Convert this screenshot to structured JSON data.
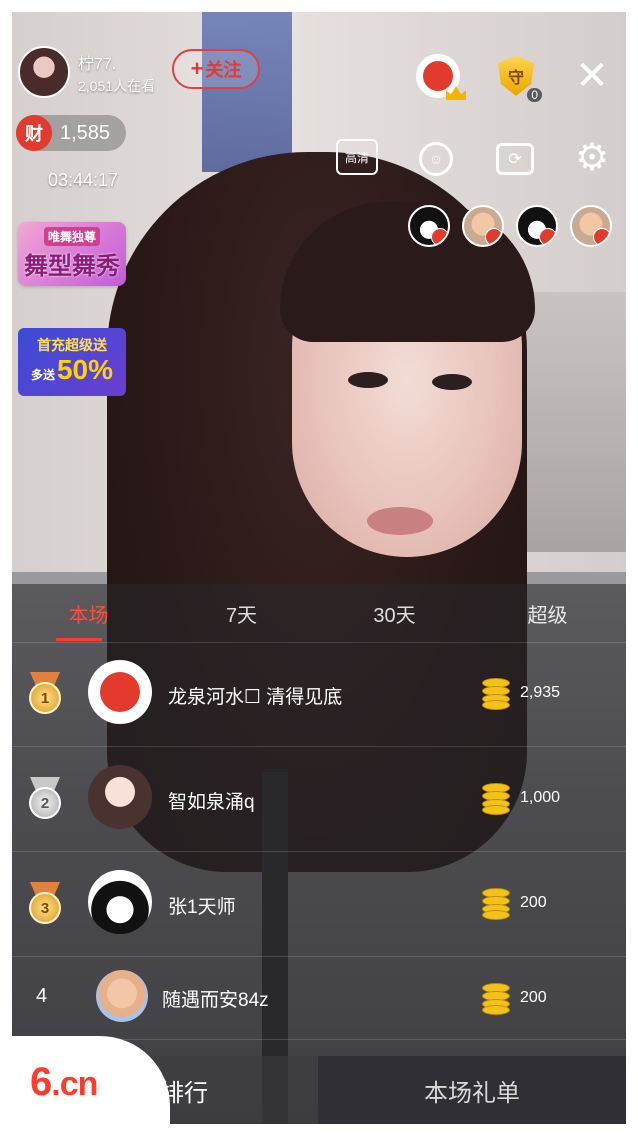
{
  "host": {
    "name": "柠77.",
    "viewers": "2,051人在看",
    "follow_label": "关注",
    "follow_plus": "+"
  },
  "wealth": {
    "icon_label": "财",
    "value": "1,585"
  },
  "timer": "03:44:17",
  "promos": {
    "banner1_top": "唯舞独尊",
    "banner1_main": "舞型舞秀",
    "banner2_top": "首充超级送",
    "banner2_prefix": "多送",
    "banner2_value": "50%"
  },
  "top_icons": {
    "guard_char": "守",
    "guard_count": "0",
    "close_glyph": "✕",
    "hd_label": "高清",
    "face_glyph": "☺",
    "camera_glyph": "⟳",
    "gear_glyph": "⚙"
  },
  "ranking": {
    "tabs": [
      "本场",
      "7天",
      "30天",
      "超级"
    ],
    "active_tab": 0,
    "rows": [
      {
        "rank": "1",
        "name": "龙泉河水☐ 清得见底",
        "score": "2,935"
      },
      {
        "rank": "2",
        "name": "智如泉涌q",
        "score": "1,000"
      },
      {
        "rank": "3",
        "name": "张1天师",
        "score": "200"
      },
      {
        "rank": "4",
        "name": "随遇而安84z",
        "score": "200"
      }
    ]
  },
  "footer": {
    "left_label": "排行",
    "right_label": "本场礼单"
  },
  "logo": {
    "number": "6",
    "suffix": ".cn"
  },
  "colors": {
    "accent": "#ff3b2f",
    "coin": "#f3c21a",
    "gold_medal": "#d99a22"
  }
}
